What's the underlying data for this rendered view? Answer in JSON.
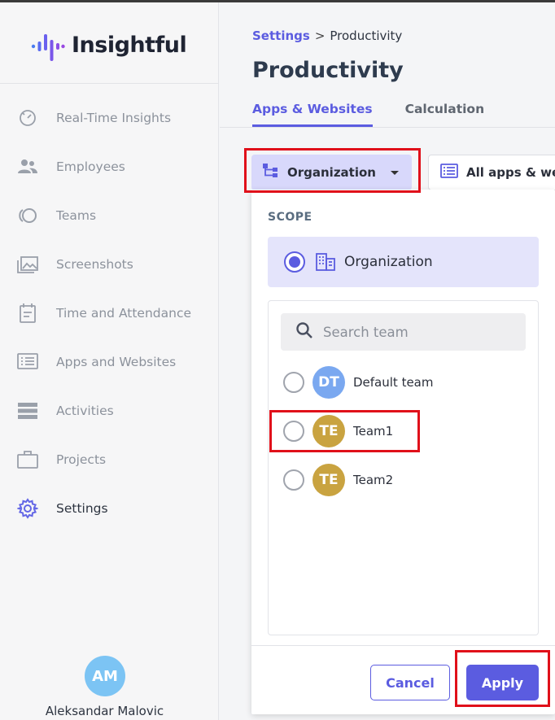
{
  "brand": {
    "name": "Insightful"
  },
  "sidebar": {
    "items": [
      {
        "label": "Real-Time Insights",
        "icon": "speedometer-icon"
      },
      {
        "label": "Employees",
        "icon": "people-icon"
      },
      {
        "label": "Teams",
        "icon": "teams-icon"
      },
      {
        "label": "Screenshots",
        "icon": "images-icon"
      },
      {
        "label": "Time and Attendance",
        "icon": "calendar-icon"
      },
      {
        "label": "Apps and Websites",
        "icon": "list-window-icon"
      },
      {
        "label": "Activities",
        "icon": "stacked-bars-icon"
      },
      {
        "label": "Projects",
        "icon": "briefcase-icon"
      },
      {
        "label": "Settings",
        "icon": "gear-icon",
        "active": true
      }
    ]
  },
  "user": {
    "initials": "AM",
    "name": "Aleksandar Malovic"
  },
  "breadcrumb": {
    "parent": "Settings",
    "separator": ">",
    "current": "Productivity"
  },
  "page": {
    "title": "Productivity"
  },
  "tabs": [
    {
      "label": "Apps & Websites",
      "active": true
    },
    {
      "label": "Calculation",
      "active": false
    }
  ],
  "filters": {
    "org_button": "Organization",
    "apps_button": "All apps & web"
  },
  "dropdown": {
    "scope_label": "SCOPE",
    "selected_scope": "Organization",
    "search_placeholder": "Search team",
    "teams": [
      {
        "initials": "DT",
        "name": "Default team",
        "color": "#7aa8f0"
      },
      {
        "initials": "TE",
        "name": "Team1",
        "color": "#c9a340"
      },
      {
        "initials": "TE",
        "name": "Team2",
        "color": "#c9a340"
      }
    ],
    "cancel_label": "Cancel",
    "apply_label": "Apply"
  },
  "colors": {
    "accent": "#5b5ce0",
    "highlight": "#e0101a"
  }
}
